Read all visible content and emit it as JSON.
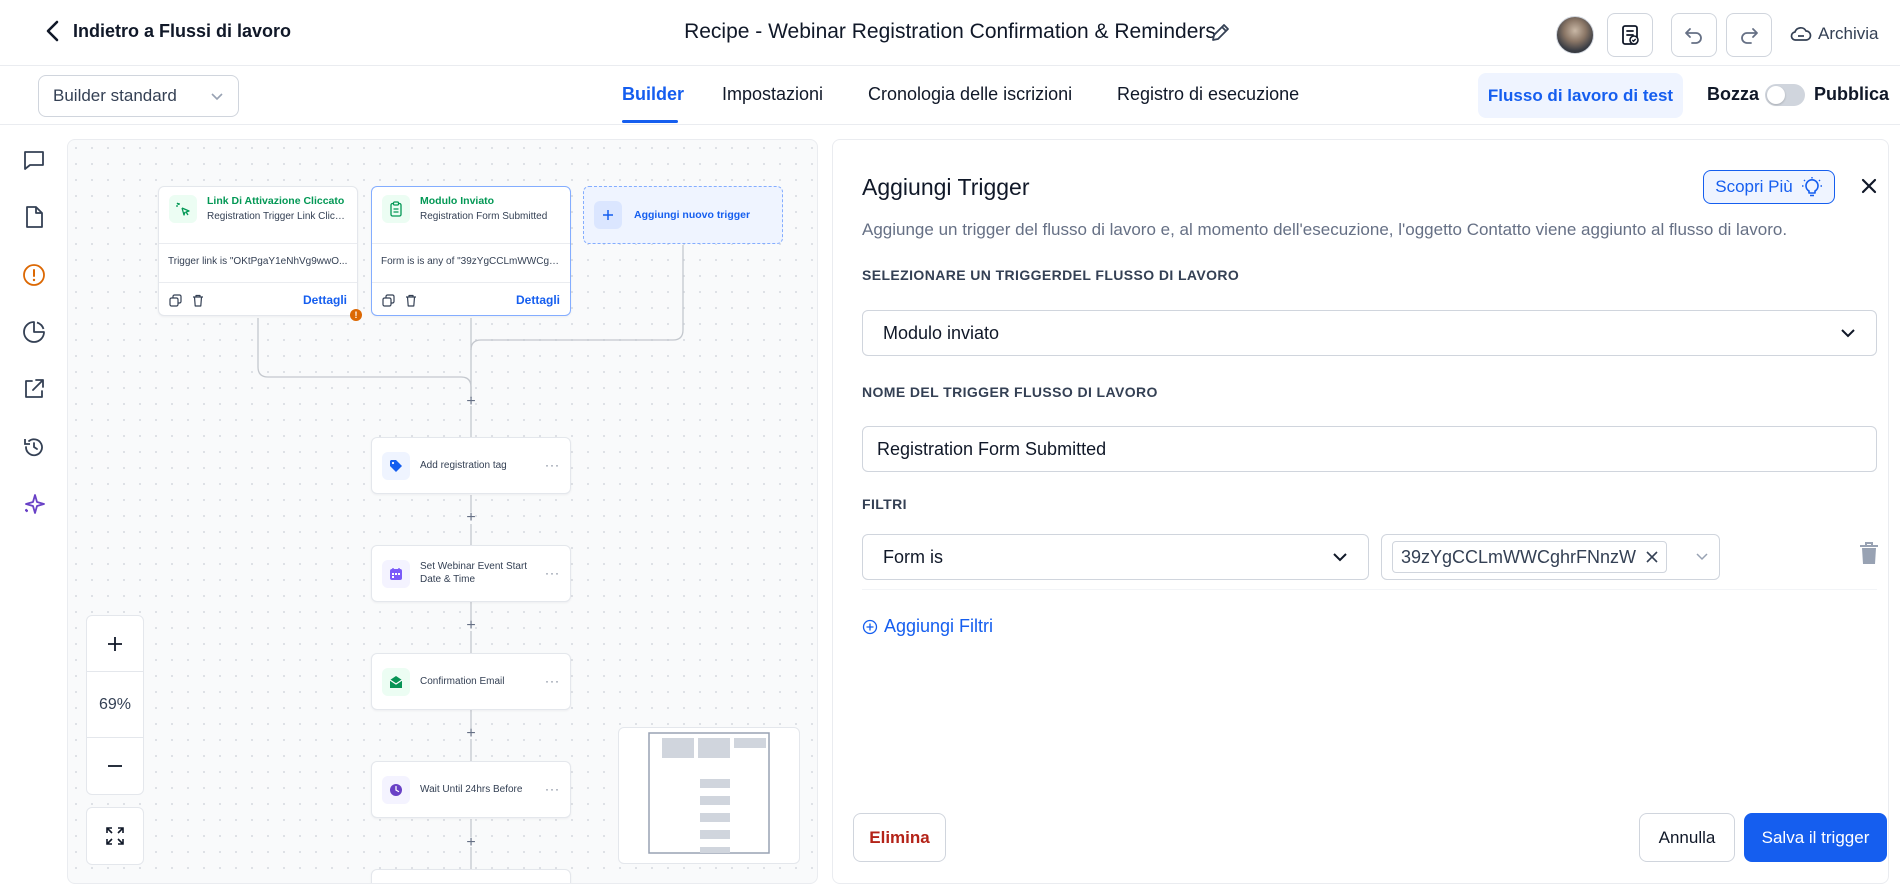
{
  "header": {
    "back_label": "Indietro a Flussi di lavoro",
    "workflow_title": "Recipe - Webinar Registration Confirmation & Reminders",
    "archive_label": "Archivia"
  },
  "subheader": {
    "builder_select": "Builder standard",
    "tabs": [
      {
        "label": "Builder",
        "active": true
      },
      {
        "label": "Impostazioni",
        "active": false
      },
      {
        "label": "Cronologia delle iscrizioni",
        "active": false
      },
      {
        "label": "Registro di esecuzione",
        "active": false
      }
    ],
    "test_button": "Flusso di lavoro di test",
    "draft_label": "Bozza",
    "publish_label": "Pubblica",
    "published": false
  },
  "sidebar_icons": [
    "chat-icon",
    "document-icon",
    "alert-icon",
    "pie-chart-icon",
    "external-link-icon",
    "history-icon",
    "sparkles-icon"
  ],
  "canvas": {
    "triggers": [
      {
        "title": "Link Di Attivazione Cliccato",
        "subtitle": "Registration Trigger Link Click...",
        "body": "Trigger link is \"OKtPgaY1eNhVg9wwO...",
        "details": "Dettagli",
        "warning": true
      },
      {
        "title": "Modulo Inviato",
        "subtitle": "Registration Form Submitted",
        "body": "Form is is any of \"39zYgCCLmWWCghr...",
        "details": "Dettagli",
        "selected": true
      }
    ],
    "add_trigger_label": "Aggiungi nuovo trigger",
    "actions": [
      {
        "label": "Add registration tag",
        "icon": "tag-icon",
        "color": "#155eef"
      },
      {
        "label": "Set Webinar Event Start Date & Time",
        "icon": "calendar-icon",
        "color": "#7a5af8"
      },
      {
        "label": "Confirmation Email",
        "icon": "mail-icon",
        "color": "#079455"
      },
      {
        "label": "Wait Until 24hrs Before",
        "icon": "clock-icon",
        "color": "#6941c6"
      }
    ],
    "zoom_level": "69%",
    "more_glyph": "···"
  },
  "panel": {
    "title": "Aggiungi Trigger",
    "learn_more": "Scopri Più",
    "description": "Aggiunge un trigger del flusso di lavoro e, al momento dell'esecuzione, l'oggetto Contatto viene aggiunto al flusso di lavoro.",
    "select_label": "SELEZIONARE UN TRIGGERDEL FLUSSO DI LAVORO",
    "select_value": "Modulo inviato",
    "name_label": "NOME DEL TRIGGER FLUSSO DI LAVORO",
    "name_value": "Registration Form Submitted",
    "filters_label": "FILTRI",
    "filter_field": "Form is",
    "filter_value": "39zYgCCLmWWCghrFNnzW",
    "add_filter": "Aggiungi Filtri",
    "delete_button": "Elimina",
    "cancel_button": "Annulla",
    "save_button": "Salva il trigger"
  },
  "colors": {
    "accent": "#155eef",
    "danger": "#b42318",
    "trigger_green": "#039855",
    "warning": "#dc6803"
  }
}
